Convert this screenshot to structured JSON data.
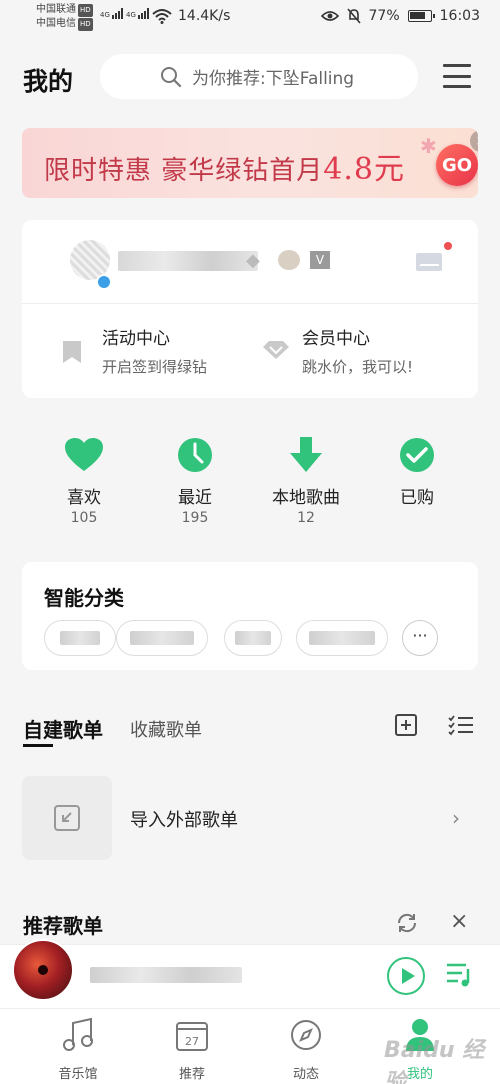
{
  "status_bar": {
    "carrier1": "中国联通",
    "carrier2": "中国电信",
    "hd_tag": "HD",
    "net_type": "4G",
    "net_speed": "14.4K/s",
    "battery": "77%",
    "time": "16:03"
  },
  "header": {
    "title": "我的",
    "search_placeholder": "为你推荐:下坠Falling"
  },
  "banner": {
    "text": "限时特惠 豪华绿钻首月",
    "price": "4.8元",
    "go_label": "GO",
    "close_label": "×"
  },
  "user_card": {
    "entries": [
      {
        "title": "活动中心",
        "subtitle": "开启签到得绿钻"
      },
      {
        "title": "会员中心",
        "subtitle": "跳水价，我可以!"
      }
    ]
  },
  "quick_actions": [
    {
      "label": "喜欢",
      "count": "105",
      "icon": "heart-icon"
    },
    {
      "label": "最近",
      "count": "195",
      "icon": "clock-icon"
    },
    {
      "label": "本地歌曲",
      "count": "12",
      "icon": "download-icon"
    },
    {
      "label": "已购",
      "count": "",
      "icon": "check-icon"
    }
  ],
  "smart_category": {
    "title": "智能分类",
    "more_label": "···"
  },
  "playlists": {
    "tab_self": "自建歌单",
    "tab_fav": "收藏歌单",
    "import_label": "导入外部歌单",
    "arrow": "›"
  },
  "recommend": {
    "title": "推荐歌单",
    "close_label": "×"
  },
  "tab_bar": {
    "tabs": [
      {
        "label": "音乐馆",
        "icon": "music-note-icon"
      },
      {
        "label": "推荐",
        "icon": "calendar-icon",
        "icon_text": "27"
      },
      {
        "label": "动态",
        "icon": "compass-icon"
      },
      {
        "label": "我的",
        "icon": "profile-icon"
      }
    ]
  },
  "watermark": "Baidu 经验",
  "colors": {
    "accent": "#31c27c",
    "banner_text": "#c23a4a",
    "go_button": "#e8334a"
  }
}
